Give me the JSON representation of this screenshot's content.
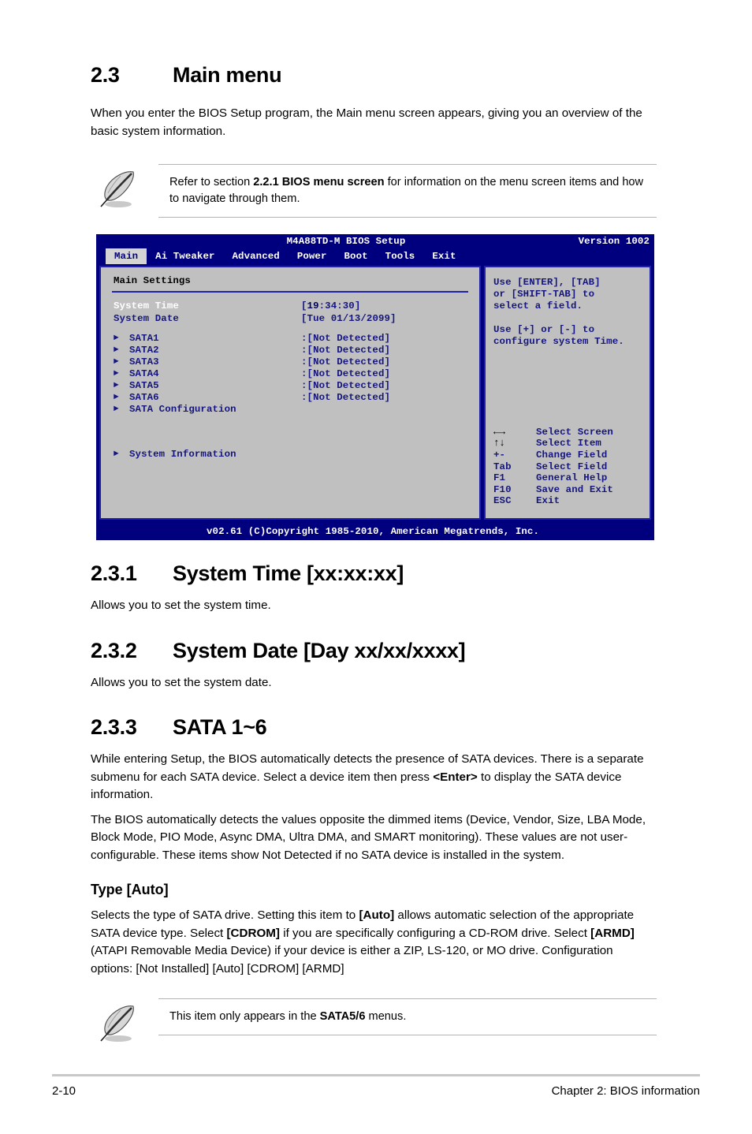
{
  "section": {
    "number": "2.3",
    "title": "Main menu",
    "intro": "When you enter the BIOS Setup program, the Main menu screen appears, giving you an overview of the basic system information."
  },
  "note_top": {
    "text_before": "Refer to section ",
    "bold": "2.2.1 BIOS menu screen",
    "text_after": " for information on the menu screen items and how to navigate through them."
  },
  "bios": {
    "title": "M4A88TD-M BIOS Setup",
    "version": "Version 1002",
    "tabs": [
      {
        "label": "Main",
        "active": true
      },
      {
        "label": "Ai Tweaker",
        "active": false
      },
      {
        "label": "Advanced",
        "active": false
      },
      {
        "label": "Power",
        "active": false
      },
      {
        "label": "Boot",
        "active": false
      },
      {
        "label": "Tools",
        "active": false
      },
      {
        "label": "Exit",
        "active": false
      }
    ],
    "panel_title": "Main Settings",
    "fields": [
      {
        "key": "System Time",
        "value_pre": "[",
        "cursor": "19",
        "value_post": ":34:30]",
        "selected": true
      },
      {
        "key": "System Date",
        "value_pre": "[",
        "cursor": "",
        "value_post": "Tue 01/13/2099]",
        "selected": false
      }
    ],
    "items": [
      {
        "label": "SATA1",
        "value": ":[Not Detected]"
      },
      {
        "label": "SATA2",
        "value": ":[Not Detected]"
      },
      {
        "label": "SATA3",
        "value": ":[Not Detected]"
      },
      {
        "label": "SATA4",
        "value": ":[Not Detected]"
      },
      {
        "label": "SATA5",
        "value": ":[Not Detected]"
      },
      {
        "label": "SATA6",
        "value": ":[Not Detected]"
      },
      {
        "label": "SATA Configuration",
        "value": ""
      }
    ],
    "items2": [
      {
        "label": "System Information",
        "value": ""
      }
    ],
    "help": [
      "Use [ENTER], [TAB]",
      "or [SHIFT-TAB] to",
      "select a field.",
      "",
      "Use [+] or [-] to",
      "configure system Time."
    ],
    "legend": [
      {
        "key": "←→",
        "action": "Select Screen",
        "arrows": true
      },
      {
        "key": "↑↓",
        "action": "Select Item",
        "arrows": true
      },
      {
        "key": "+-",
        "action": "Change Field",
        "arrows": false
      },
      {
        "key": "Tab",
        "action": "Select Field",
        "arrows": false
      },
      {
        "key": "F1",
        "action": "General Help",
        "arrows": false
      },
      {
        "key": "F10",
        "action": "Save and Exit",
        "arrows": false
      },
      {
        "key": "ESC",
        "action": "Exit",
        "arrows": false
      }
    ],
    "footer": "v02.61 (C)Copyright 1985-2010, American Megatrends, Inc.",
    "colors": {
      "bg": "#00007e",
      "panel": "#c0c0c0",
      "panel_border": "#2020a8",
      "text": "#151580",
      "highlight": "#ffffff",
      "tab_active_bg": "#d4d4d4"
    }
  },
  "sub_sections": [
    {
      "number": "2.3.1",
      "title": "System Time [xx:xx:xx]",
      "body": "Allows you to set the system time."
    },
    {
      "number": "2.3.2",
      "title": "System Date [Day xx/xx/xxxx]",
      "body": "Allows you to set the system date."
    },
    {
      "number": "2.3.3",
      "title": "SATA 1~6"
    }
  ],
  "sata_paragraphs": {
    "p1_a": "While entering Setup, the BIOS automatically detects the presence of SATA devices. There is a separate submenu for each SATA device. Select a device item then press ",
    "p1_b": "<Enter>",
    "p1_c": " to display the SATA device information.",
    "p2": "The BIOS automatically detects the values opposite the dimmed items (Device, Vendor, Size, LBA Mode, Block Mode, PIO Mode, Async DMA, Ultra DMA, and SMART monitoring). These values are not user-configurable. These items show Not Detected if no SATA device is installed in the system."
  },
  "type_section": {
    "heading": "Type [Auto]",
    "p_a": "Selects the type of SATA drive. Setting this item to ",
    "p_b": "[Auto]",
    "p_c": " allows automatic selection of the appropriate SATA device type. Select ",
    "p_d": "[CDROM]",
    "p_e": " if you are specifically configuring a CD-ROM drive. Select ",
    "p_f": "[ARMD]",
    "p_g": " (ATAPI Removable Media Device) if your device is either a ZIP, LS-120, or MO drive. Configuration options: [Not Installed] [Auto] [CDROM] [ARMD]"
  },
  "note_bottom": {
    "text_before": "This item only appears in the ",
    "bold": "SATA5/6",
    "text_after": " menus."
  },
  "footer": {
    "page": "2-10",
    "chapter": "Chapter 2: BIOS information"
  }
}
